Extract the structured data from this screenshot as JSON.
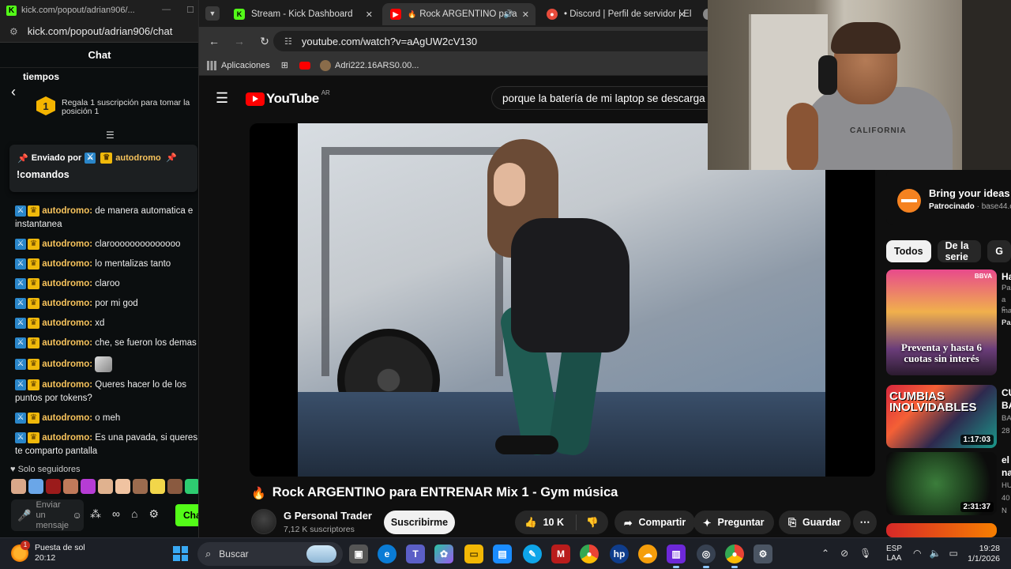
{
  "kick": {
    "window_title": "kick.com/popout/adrian906/...",
    "url": "kick.com/popout/adrian906/chat",
    "chat_heading": "Chat",
    "leaderboard_label": "tiempos",
    "rank_number": "1",
    "gift_message": "Regala 1 suscripción para tomar la posición 1",
    "pinned": {
      "sent_by_label": "Enviado por",
      "username": "autodromo",
      "message": "!comandos"
    },
    "messages": [
      {
        "user": "autodromo:",
        "text": "de manera automatica e instantanea"
      },
      {
        "user": "autodromo:",
        "text": "claroooooooooooooo"
      },
      {
        "user": "autodromo:",
        "text": "lo mentalizas tanto"
      },
      {
        "user": "autodromo:",
        "text": "claroo"
      },
      {
        "user": "autodromo:",
        "text": "por mi god"
      },
      {
        "user": "autodromo:",
        "text": "xd"
      },
      {
        "user": "autodromo:",
        "text": "che, se fueron los demas"
      },
      {
        "user": "autodromo:",
        "text": ""
      },
      {
        "user": "autodromo:",
        "text": "Queres hacer lo de los puntos por tokens?"
      },
      {
        "user": "autodromo:",
        "text": "o meh"
      },
      {
        "user": "autodromo:",
        "text": "Es una pavada, si queres te comparto pantalla"
      }
    ],
    "followers_only": "Solo seguidores",
    "input_placeholder": "Enviar un mensaje",
    "send_button": "Chat"
  },
  "chrome": {
    "tabs": [
      {
        "title": "Stream - Kick Dashboard",
        "icon": "kick-icon"
      },
      {
        "title": "Rock ARGENTINO para",
        "icon": "youtube-icon"
      },
      {
        "title": "• Discord | Perfil de servidor | El",
        "icon": "discord-icon"
      }
    ],
    "address": "youtube.com/watch?v=aAgUW2cV130",
    "bookmarks": [
      {
        "label": "Aplicaciones"
      },
      {
        "label": "Adri222.16ARS0.00..."
      }
    ]
  },
  "youtube": {
    "logo_text": "YouTube",
    "country_code": "AR",
    "search_query": "porque la batería de mi laptop se descarga r",
    "video_title": "Rock ARGENTINO para ENTRENAR Mix 1 - Gym música",
    "channel_name": "G Personal Trader",
    "channel_subs": "7,12 K suscriptores",
    "subscribe_label": "Suscribirme",
    "likes": "10 K",
    "share_label": "Compartir",
    "ask_label": "Preguntar",
    "save_label": "Guardar",
    "ad": {
      "title": "Bring your ideas t",
      "sponsored": "Patrocinado",
      "domain": "base44.co"
    },
    "chips": [
      "Todos",
      "De la serie",
      "G"
    ],
    "recommendations": [
      {
        "promo": "Preventa y hasta 6 cuotas sin interés",
        "badge": "BBVA",
        "title_fragment": "Ha",
        "sub": "Pa",
        "sub2": "a c",
        "sub3": "ma",
        "sub4": "Pa"
      },
      {
        "thumb_text": "CUMBIAS INOLVIDABLES",
        "duration": "1:17:03",
        "title_fragment": "CU",
        "title_fragment2": "BA",
        "sub": "BA",
        "sub2": "28"
      },
      {
        "duration": "2:31:37",
        "title_fragment": "el",
        "title_fragment2": "na",
        "sub": "HU",
        "sub2": "40",
        "sub3": "N"
      }
    ]
  },
  "webcam": {
    "shirt_text": "CALIFORNIA"
  },
  "taskbar": {
    "weather_title": "Puesta de sol",
    "weather_time": "20:12",
    "search_label": "Buscar",
    "language": "ESP",
    "region": "LAA",
    "time": "19:28",
    "date": "1/1/2026"
  }
}
